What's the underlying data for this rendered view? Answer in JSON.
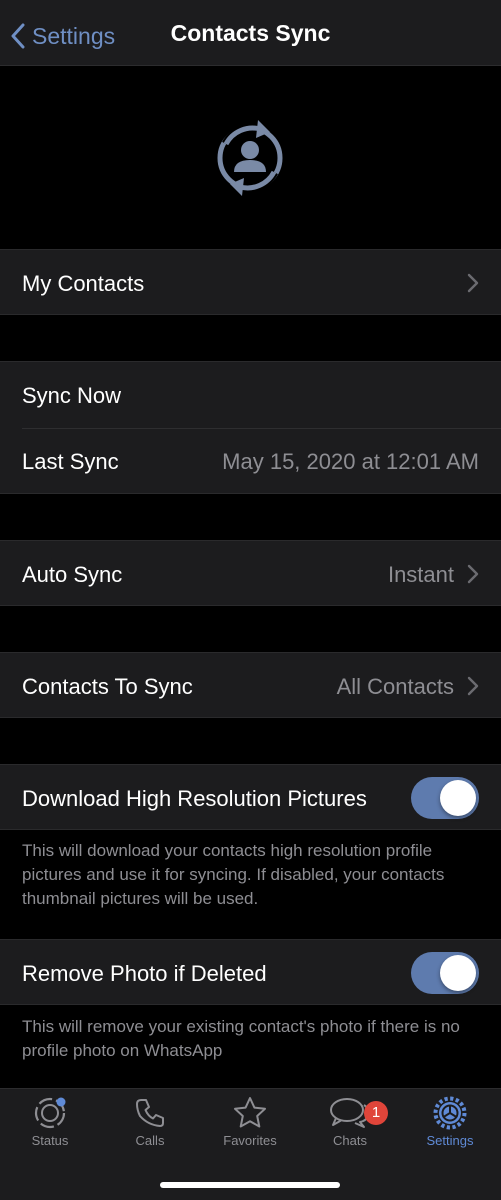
{
  "nav": {
    "back_label": "Settings",
    "title": "Contacts Sync"
  },
  "hero": {
    "icon": "contacts-sync-icon"
  },
  "sections": {
    "my_contacts": {
      "label": "My Contacts"
    },
    "sync_now": {
      "label": "Sync Now"
    },
    "last_sync": {
      "label": "Last Sync",
      "value": "May 15, 2020 at 12:01 AM"
    },
    "auto_sync": {
      "label": "Auto Sync",
      "value": "Instant"
    },
    "contacts_to_sync": {
      "label": "Contacts To Sync",
      "value": "All Contacts"
    },
    "download_hi_res": {
      "label": "Download High Resolution Pictures",
      "enabled": true,
      "footnote": "This will download your contacts high resolution profile pictures and use it for syncing. If disabled, your contacts thumbnail pictures will be used."
    },
    "remove_photo": {
      "label": "Remove Photo if Deleted",
      "enabled": true,
      "footnote": "This will remove your existing contact's photo if there is no profile photo on WhatsApp"
    }
  },
  "tabbar": {
    "tabs": [
      {
        "label": "Status",
        "icon": "status-icon"
      },
      {
        "label": "Calls",
        "icon": "phone-icon"
      },
      {
        "label": "Favorites",
        "icon": "star-icon"
      },
      {
        "label": "Chats",
        "icon": "chat-bubbles-icon",
        "badge": "1"
      },
      {
        "label": "Settings",
        "icon": "gear-icon",
        "active": true
      }
    ]
  },
  "colors": {
    "accent": "#6f8fc4",
    "toggle_on": "#5e7bae",
    "badge": "#e0453a",
    "active_tab": "#5f8ad6"
  }
}
